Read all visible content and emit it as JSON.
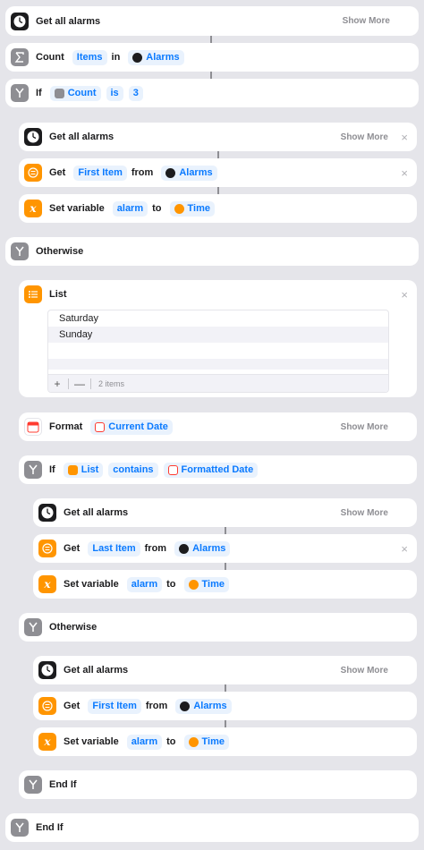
{
  "actions": {
    "get_all_alarms_1": {
      "title": "Get all alarms",
      "show_more": "Show More"
    },
    "count": {
      "title": "Count",
      "token_items": "Items",
      "word_in": "in",
      "token_alarms": "Alarms"
    },
    "if_1": {
      "title": "If",
      "token_count": "Count",
      "token_is": "is",
      "token_value": "3"
    },
    "get_all_alarms_2": {
      "title": "Get all alarms",
      "show_more": "Show More",
      "close": "×"
    },
    "get_first_1": {
      "title": "Get",
      "token_item": "First Item",
      "word_from": "from",
      "token_alarms": "Alarms",
      "close": "×"
    },
    "set_var_1": {
      "title": "Set variable",
      "token_name": "alarm",
      "word_to": "to",
      "token_value": "Time"
    },
    "otherwise_1": {
      "title": "Otherwise"
    },
    "list": {
      "title": "List",
      "close": "×",
      "items": [
        "Saturday",
        "Sunday"
      ],
      "add": "+",
      "remove": "—",
      "count_label": "2 items"
    },
    "format": {
      "title": "Format",
      "token_date": "Current Date",
      "show_more": "Show More"
    },
    "if_2": {
      "title": "If",
      "token_list": "List",
      "token_contains": "contains",
      "token_formatted": "Formatted Date"
    },
    "get_all_alarms_3": {
      "title": "Get all alarms",
      "show_more": "Show More"
    },
    "get_last": {
      "title": "Get",
      "token_item": "Last Item",
      "word_from": "from",
      "token_alarms": "Alarms",
      "close": "×"
    },
    "set_var_2": {
      "title": "Set variable",
      "token_name": "alarm",
      "word_to": "to",
      "token_value": "Time"
    },
    "otherwise_2": {
      "title": "Otherwise"
    },
    "get_all_alarms_4": {
      "title": "Get all alarms",
      "show_more": "Show More"
    },
    "get_first_2": {
      "title": "Get",
      "token_item": "First Item",
      "word_from": "from",
      "token_alarms": "Alarms"
    },
    "set_var_3": {
      "title": "Set variable",
      "token_name": "alarm",
      "word_to": "to",
      "token_value": "Time"
    },
    "end_if_1": {
      "title": "End If"
    },
    "end_if_2": {
      "title": "End If"
    }
  },
  "colors": {
    "background": "#e5e5ea",
    "card": "#ffffff",
    "token_text": "#0a7aff",
    "token_bg": "#e9f2fd",
    "orange": "#ff9500",
    "gray": "#8e8e93"
  },
  "icons": {
    "alarm": "clock-icon",
    "count": "sigma-icon",
    "if": "branch-icon",
    "get_item": "list-item-icon",
    "set_variable": "variable-x-icon",
    "list": "list-icon",
    "format": "calendar-icon"
  }
}
